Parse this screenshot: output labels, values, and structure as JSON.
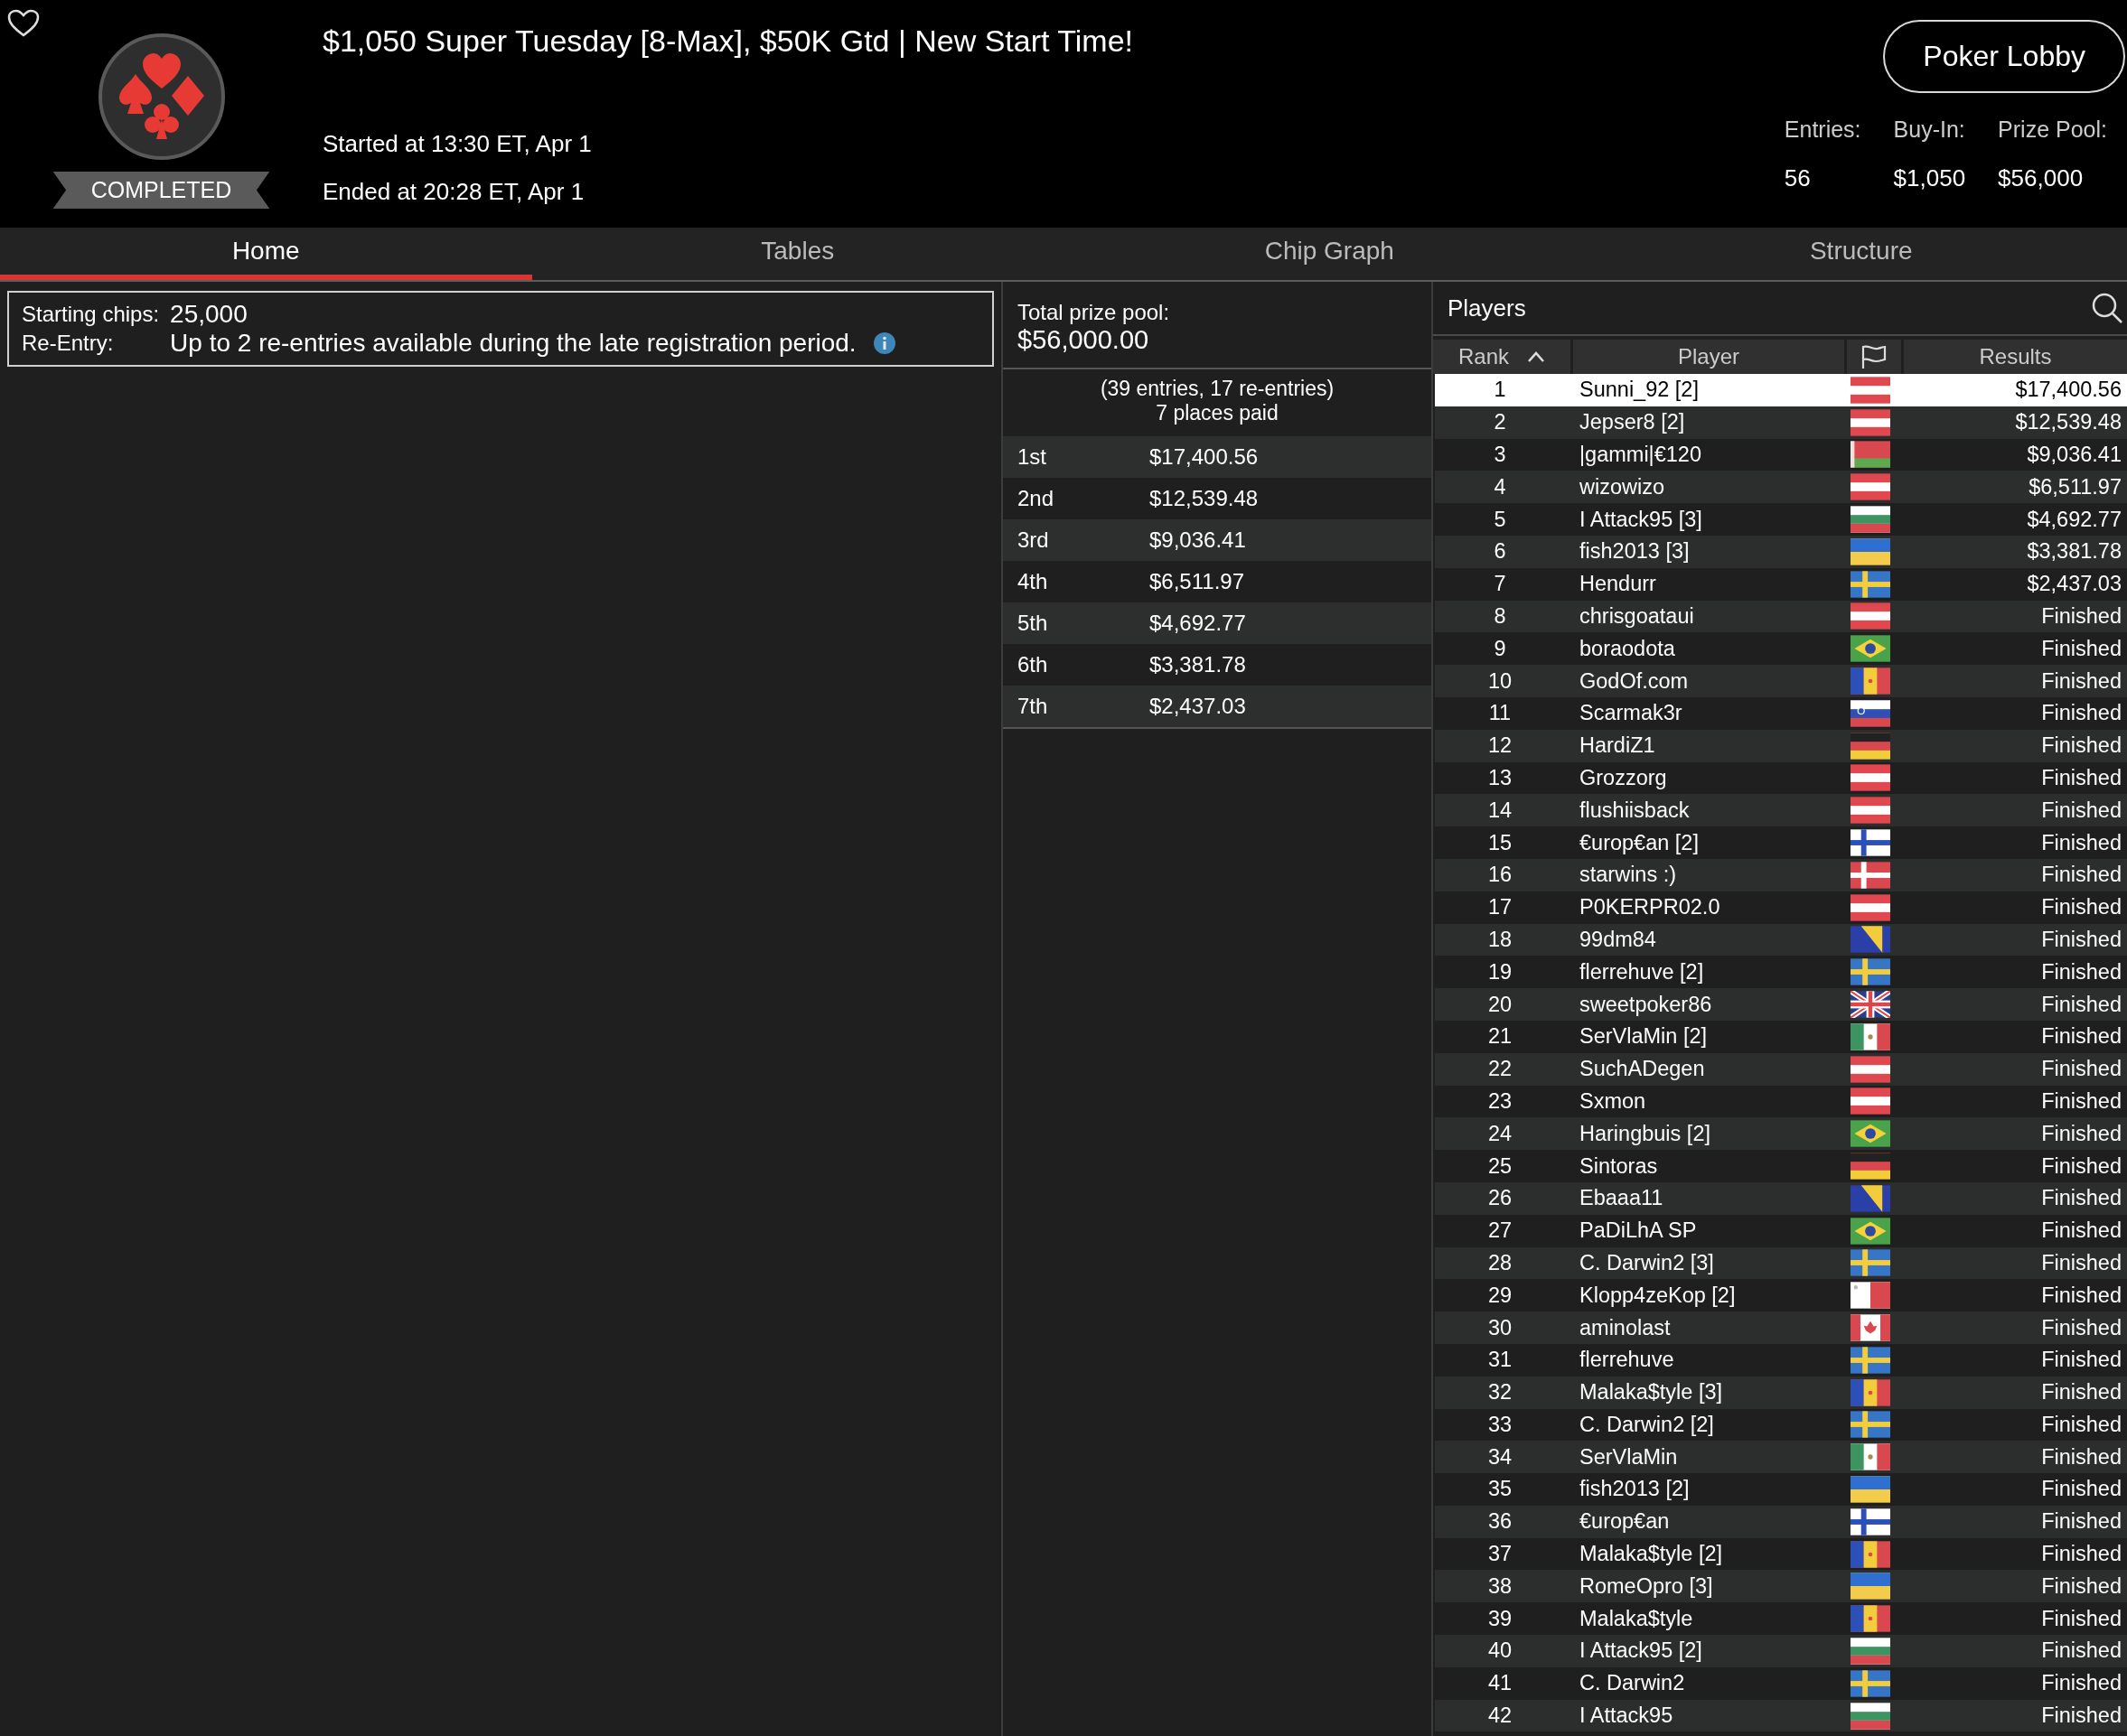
{
  "header": {
    "status": "COMPLETED",
    "title": "$1,050 Super Tuesday [8-Max], $50K Gtd | New Start Time!",
    "started": "Started at 13:30 ET, Apr 1",
    "ended": "Ended at 20:28 ET, Apr 1",
    "lobby_button": "Poker Lobby",
    "stats": [
      {
        "label": "Entries:",
        "value": "56"
      },
      {
        "label": "Buy-In:",
        "value": "$1,050"
      },
      {
        "label": "Prize Pool:",
        "value": "$56,000"
      }
    ]
  },
  "tabs": [
    {
      "label": "Home",
      "selected": true
    },
    {
      "label": "Tables",
      "selected": false
    },
    {
      "label": "Chip Graph",
      "selected": false
    },
    {
      "label": "Structure",
      "selected": false
    }
  ],
  "info": {
    "rows": [
      {
        "label": "Starting chips:",
        "value": "25,000",
        "has_info": false
      },
      {
        "label": "Re-Entry:",
        "value": "Up to 2 re-entries available during the late registration period.",
        "has_info": true
      }
    ]
  },
  "prizes": {
    "label": "Total prize pool:",
    "total": "$56,000.00",
    "entries_note": "(39 entries, 17 re-entries)",
    "places_note": "7 places paid",
    "payouts": [
      {
        "place": "1st",
        "amount": "$17,400.56"
      },
      {
        "place": "2nd",
        "amount": "$12,539.48"
      },
      {
        "place": "3rd",
        "amount": "$9,036.41"
      },
      {
        "place": "4th",
        "amount": "$6,511.97"
      },
      {
        "place": "5th",
        "amount": "$4,692.77"
      },
      {
        "place": "6th",
        "amount": "$3,381.78"
      },
      {
        "place": "7th",
        "amount": "$2,437.03"
      }
    ]
  },
  "players": {
    "title": "Players",
    "columns": [
      {
        "kind": "text",
        "label": "Rank",
        "sorted": true
      },
      {
        "kind": "text",
        "label": "Player",
        "sorted": false
      },
      {
        "kind": "flag",
        "sorted": false
      },
      {
        "kind": "text",
        "label": "Results",
        "sorted": false
      }
    ],
    "rows": [
      {
        "rank": "1",
        "player": "Sunni_92 [2]",
        "kind": "austria",
        "result": "$17,400.56",
        "selected": true
      },
      {
        "rank": "2",
        "player": "Jepser8 [2]",
        "kind": "austria",
        "result": "$12,539.48",
        "selected": false
      },
      {
        "rank": "3",
        "player": "|gammi|€120",
        "kind": "belarus",
        "result": "$9,036.41",
        "selected": false
      },
      {
        "rank": "4",
        "player": "wizowizo",
        "kind": "austria",
        "result": "$6,511.97",
        "selected": false
      },
      {
        "rank": "5",
        "player": "I Attack95 [3]",
        "kind": "bulgaria",
        "result": "$4,692.77",
        "selected": false
      },
      {
        "rank": "6",
        "player": "fish2013 [3]",
        "kind": "ukraine",
        "result": "$3,381.78",
        "selected": false
      },
      {
        "rank": "7",
        "player": "Hendurr",
        "kind": "sweden",
        "result": "$2,437.03",
        "selected": false
      },
      {
        "rank": "8",
        "player": "chrisgoataui",
        "kind": "austria",
        "result": "Finished",
        "selected": false
      },
      {
        "rank": "9",
        "player": "boraodota",
        "kind": "brazil",
        "result": "Finished",
        "selected": false
      },
      {
        "rank": "10",
        "player": "GodOf.com",
        "kind": "moldova",
        "result": "Finished",
        "selected": false
      },
      {
        "rank": "11",
        "player": "Scarmak3r",
        "kind": "slovenia",
        "result": "Finished",
        "selected": false
      },
      {
        "rank": "12",
        "player": "HardiZ1",
        "kind": "germany",
        "result": "Finished",
        "selected": false
      },
      {
        "rank": "13",
        "player": "Grozzorg",
        "kind": "austria",
        "result": "Finished",
        "selected": false
      },
      {
        "rank": "14",
        "player": "flushiisback",
        "kind": "austria",
        "result": "Finished",
        "selected": false
      },
      {
        "rank": "15",
        "player": "€urop€an [2]",
        "kind": "finland",
        "result": "Finished",
        "selected": false
      },
      {
        "rank": "16",
        "player": "starwins :)",
        "kind": "denmark",
        "result": "Finished",
        "selected": false
      },
      {
        "rank": "17",
        "player": "P0KERPR02.0",
        "kind": "austria",
        "result": "Finished",
        "selected": false
      },
      {
        "rank": "18",
        "player": "99dm84",
        "kind": "bosnia",
        "result": "Finished",
        "selected": false
      },
      {
        "rank": "19",
        "player": "flerrehuve [2]",
        "kind": "sweden",
        "result": "Finished",
        "selected": false
      },
      {
        "rank": "20",
        "player": "sweetpoker86",
        "kind": "britain",
        "result": "Finished",
        "selected": false
      },
      {
        "rank": "21",
        "player": "SerVlaMin [2]",
        "kind": "mexico",
        "result": "Finished",
        "selected": false
      },
      {
        "rank": "22",
        "player": "SuchADegen",
        "kind": "austria",
        "result": "Finished",
        "selected": false
      },
      {
        "rank": "23",
        "player": "Sxmon",
        "kind": "austria",
        "result": "Finished",
        "selected": false
      },
      {
        "rank": "24",
        "player": "Haringbuis [2]",
        "kind": "brazil",
        "result": "Finished",
        "selected": false
      },
      {
        "rank": "25",
        "player": "Sintoras",
        "kind": "germany",
        "result": "Finished",
        "selected": false
      },
      {
        "rank": "26",
        "player": "Ebaaa11",
        "kind": "bosnia",
        "result": "Finished",
        "selected": false
      },
      {
        "rank": "27",
        "player": "PaDiLhA SP",
        "kind": "brazil",
        "result": "Finished",
        "selected": false
      },
      {
        "rank": "28",
        "player": "C. Darwin2 [3]",
        "kind": "sweden",
        "result": "Finished",
        "selected": false
      },
      {
        "rank": "29",
        "player": "Klopp4zeKop [2]",
        "kind": "malta",
        "result": "Finished",
        "selected": false
      },
      {
        "rank": "30",
        "player": "aminolast",
        "kind": "canada",
        "result": "Finished",
        "selected": false
      },
      {
        "rank": "31",
        "player": "flerrehuve",
        "kind": "sweden",
        "result": "Finished",
        "selected": false
      },
      {
        "rank": "32",
        "player": "Malaka$tyle [3]",
        "kind": "moldova",
        "result": "Finished",
        "selected": false
      },
      {
        "rank": "33",
        "player": "C. Darwin2 [2]",
        "kind": "sweden",
        "result": "Finished",
        "selected": false
      },
      {
        "rank": "34",
        "player": "SerVlaMin",
        "kind": "mexico",
        "result": "Finished",
        "selected": false
      },
      {
        "rank": "35",
        "player": "fish2013 [2]",
        "kind": "ukraine",
        "result": "Finished",
        "selected": false
      },
      {
        "rank": "36",
        "player": "€urop€an",
        "kind": "finland",
        "result": "Finished",
        "selected": false
      },
      {
        "rank": "37",
        "player": "Malaka$tyle [2]",
        "kind": "moldova",
        "result": "Finished",
        "selected": false
      },
      {
        "rank": "38",
        "player": "RomeOpro [3]",
        "kind": "ukraine",
        "result": "Finished",
        "selected": false
      },
      {
        "rank": "39",
        "player": "Malaka$tyle",
        "kind": "moldova",
        "result": "Finished",
        "selected": false
      },
      {
        "rank": "40",
        "player": "I Attack95 [2]",
        "kind": "bulgaria",
        "result": "Finished",
        "selected": false
      },
      {
        "rank": "41",
        "player": "C. Darwin2",
        "kind": "sweden",
        "result": "Finished",
        "selected": false
      },
      {
        "rank": "42",
        "player": "I Attack95",
        "kind": "bulgaria",
        "result": "Finished",
        "selected": false
      }
    ]
  }
}
